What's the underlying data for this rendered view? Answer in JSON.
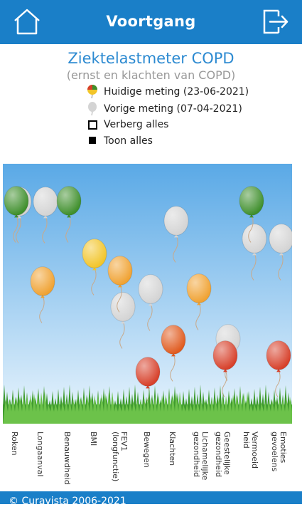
{
  "header": {
    "title": "Voortgang",
    "home_icon": "home-icon",
    "logout_icon": "logout-icon",
    "color": "#1a7fc8"
  },
  "chart_data": {
    "type": "scatter",
    "title": "Ziektelastmeter COPD",
    "subtitle": "(ernst en klachten van COPD)",
    "legend": {
      "current_label": "Huidige meting (23-06-2021)",
      "previous_label": "Vorige meting (07-04-2021)",
      "hide_all_label": "Verberg alles",
      "show_all_label": "Toon alles"
    },
    "categories": [
      "Roken",
      "Longaanval",
      "Benauwdheid",
      "BMI",
      "FEV1\n(longfunctie)",
      "Bewegen",
      "Klachten",
      "Lichamelijke\ngezondheid",
      "Geestelijke\ngezondheid",
      "Vermoeid\nheid",
      "Emoties\ngevoelens"
    ],
    "series": [
      {
        "name": "Huidige meting (23-06-2021)",
        "values": [
          {
            "category": "Roken",
            "status": "green"
          },
          {
            "category": "Longaanval",
            "status": "orange"
          },
          {
            "category": "Benauwdheid",
            "status": "green"
          },
          {
            "category": "BMI",
            "status": "yellow"
          },
          {
            "category": "FEV1\n(longfunctie)",
            "status": "orange"
          },
          {
            "category": "Bewegen",
            "status": "red"
          },
          {
            "category": "Klachten",
            "status": "orange-red"
          },
          {
            "category": "Lichamelijke\ngezondheid",
            "status": "orange"
          },
          {
            "category": "Geestelijke\ngezondheid",
            "status": "red"
          },
          {
            "category": "Vermoeid\nheid",
            "status": "green"
          },
          {
            "category": "Emoties\ngevoelens",
            "status": "red"
          }
        ]
      },
      {
        "name": "Vorige meting (07-04-2021)",
        "values": [
          {
            "category": "Roken",
            "status": "grey"
          },
          {
            "category": "Longaanval",
            "status": "grey"
          },
          {
            "category": "FEV1\n(longfunctie)",
            "status": "grey"
          },
          {
            "category": "Bewegen",
            "status": "grey"
          },
          {
            "category": "Klachten",
            "status": "grey"
          },
          {
            "category": "Geestelijke\ngezondheid",
            "status": "grey"
          },
          {
            "category": "Vermoeid\nheid",
            "status": "grey"
          },
          {
            "category": "Emoties\ngevoelens",
            "status": "grey"
          }
        ]
      }
    ],
    "colors": {
      "green": "#3f8f2c",
      "yellow": "#f2c52a",
      "orange": "#f0a232",
      "orange-red": "#e05a1e",
      "red": "#d7402a",
      "grey": "#d4d4d4",
      "sky_top": "#5aa9e6",
      "sky_bottom": "#e8f4fc",
      "grass": "#4cb13b"
    }
  },
  "footer": {
    "copyright": "© Curavista 2006-2021"
  }
}
